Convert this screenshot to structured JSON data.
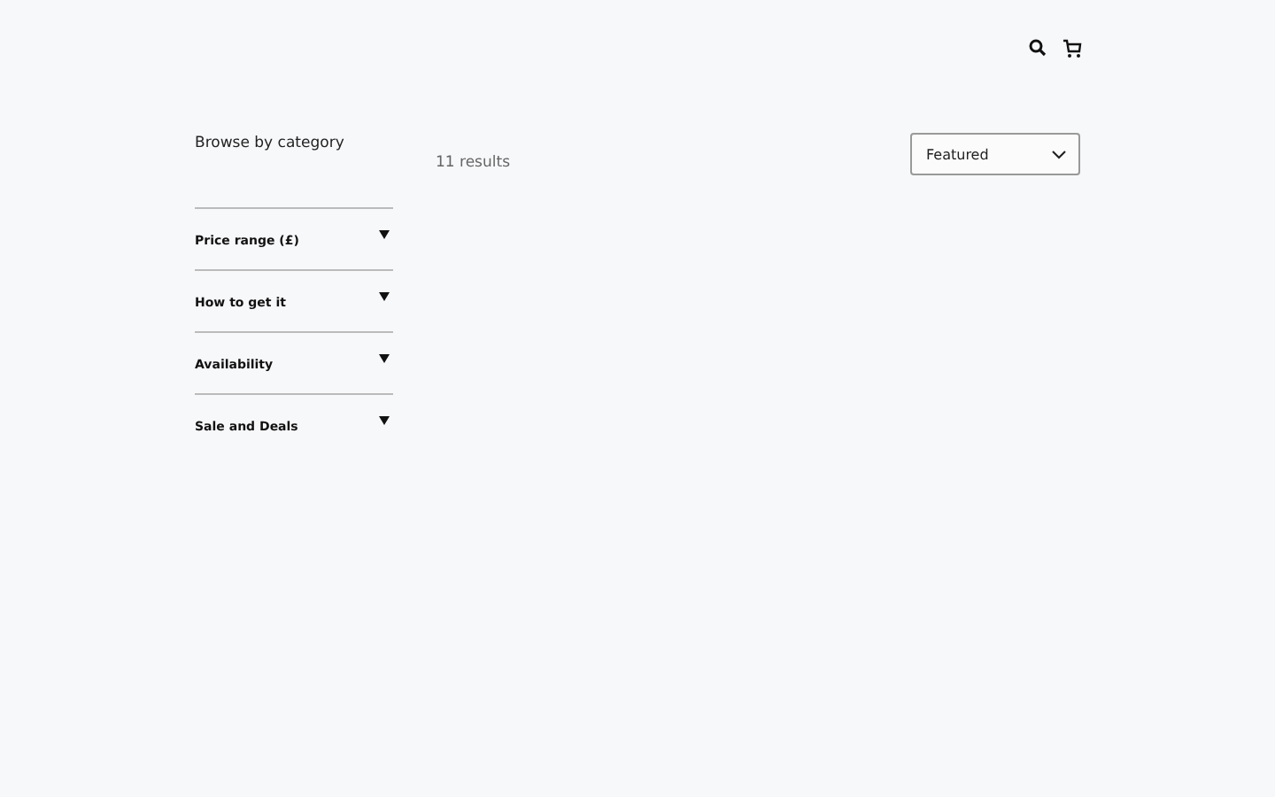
{
  "sidebar": {
    "title": "Browse by category",
    "filters": [
      {
        "label": "Price range (£)",
        "expanded": false
      },
      {
        "label": "How to get it",
        "expanded": false
      },
      {
        "label": "Availability",
        "expanded": false
      },
      {
        "label": "Sale and Deals",
        "expanded": false
      }
    ]
  },
  "results": {
    "count": "11 results"
  },
  "sort": {
    "value": "Featured"
  }
}
